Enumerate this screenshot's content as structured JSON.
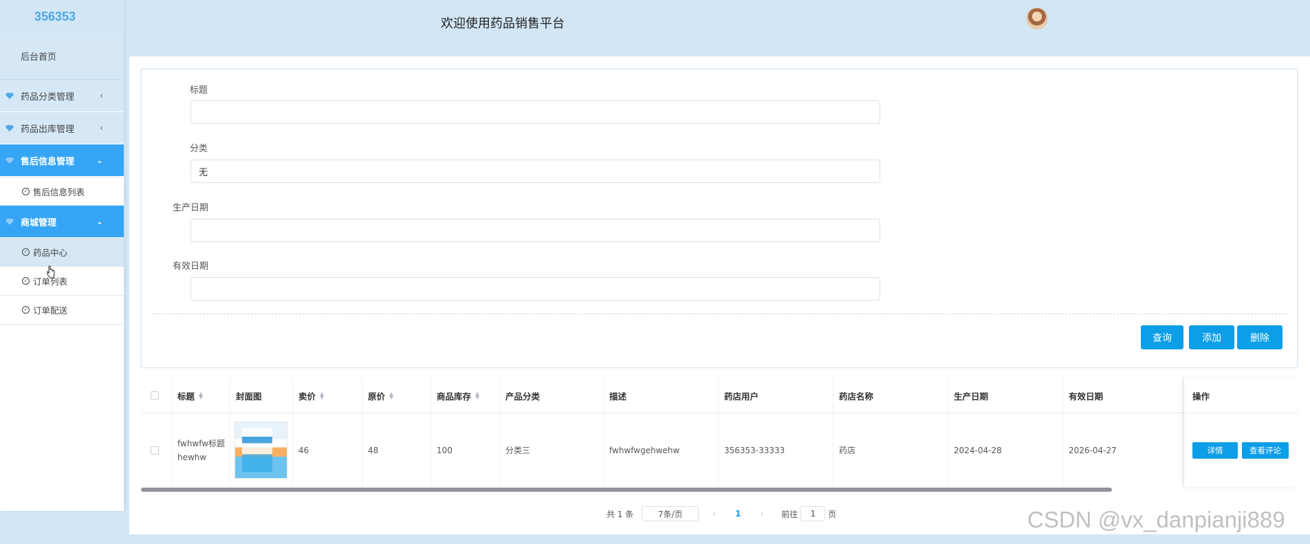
{
  "sidebar": {
    "logo": "356353",
    "home": "后台首页",
    "groups": [
      {
        "label": "药品分类管理",
        "arrow": "‹",
        "active": false
      },
      {
        "label": "药品出库管理",
        "arrow": "‹",
        "active": false
      },
      {
        "label": "售后信息管理",
        "arrow": "⌄",
        "active": true
      },
      {
        "label": "商城管理",
        "arrow": "⌄",
        "active": true
      }
    ],
    "sub_aftersale": [
      "售后信息列表"
    ],
    "sub_mall": [
      "药品中心",
      "订单列表",
      "订单配送"
    ]
  },
  "header": {
    "title": "欢迎使用药品销售平台"
  },
  "search": {
    "title_label": "标题",
    "title_value": "",
    "category_label": "分类",
    "category_value": "无",
    "production_label": "生产日期",
    "production_value": "",
    "expiry_label": "有效日期",
    "expiry_value": "",
    "query_btn": "查询",
    "add_btn": "添加",
    "delete_btn": "删除"
  },
  "table": {
    "columns": [
      "标题",
      "封面图",
      "卖价",
      "原价",
      "商品库存",
      "产品分类",
      "描述",
      "药店用户",
      "药店名称",
      "生产日期",
      "有效日期",
      "操作"
    ],
    "rows": [
      {
        "title": "fwhwfw标题hewhw",
        "price": "46",
        "original_price": "48",
        "stock": "100",
        "category": "分类三",
        "description": "fwhwfwgehwehw",
        "store_user": "356353-33333",
        "store_name": "药店",
        "production_date": "2024-04-28",
        "expiry_date": "2026-04-27",
        "detail_btn": "详情",
        "comment_btn": "查看评论"
      }
    ]
  },
  "pagination": {
    "total": "共 1 条",
    "page_size": "7条/页",
    "current": "1",
    "goto_prefix": "前往",
    "goto_value": "1",
    "goto_suffix": "页"
  },
  "watermark": "CSDN @vx_danpianji889",
  "colors": {
    "accent": "#0d9ee8",
    "sidebar_active": "#36a5f5",
    "background": "#d2e6f5"
  }
}
